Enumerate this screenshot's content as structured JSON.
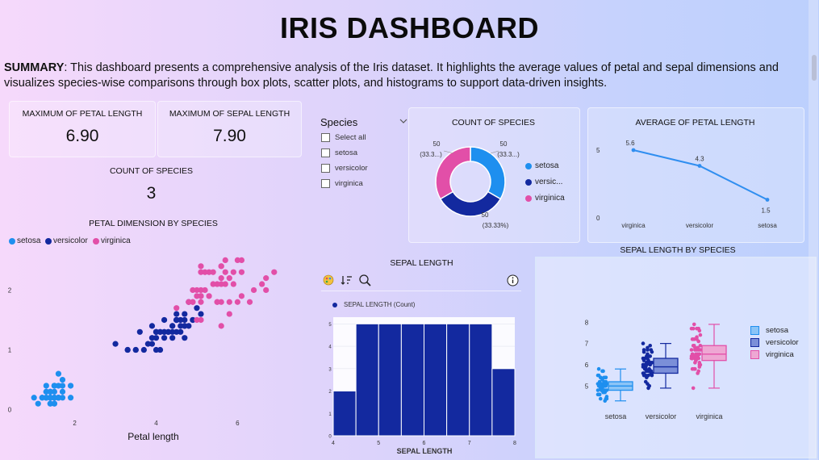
{
  "header": {
    "title": "IRIS DASHBOARD"
  },
  "summary": {
    "label": "SUMMARY",
    "text": ": This dashboard presents a comprehensive analysis of the Iris dataset. It highlights the average values of petal and sepal dimensions and visualizes species-wise comparisons through box plots, scatter plots, and histograms to support data-driven insights."
  },
  "kpis": {
    "max_petal": {
      "label": "MAXIMUM OF PETAL LENGTH",
      "value": "6.90"
    },
    "max_sepal": {
      "label": "MAXIMUM OF SEPAL LENGTH",
      "value": "7.90"
    },
    "count": {
      "label": "COUNT OF SPECIES",
      "value": "3"
    }
  },
  "slicer": {
    "title": "Species",
    "items": [
      "Select all",
      "setosa",
      "versicolor",
      "virginica"
    ]
  },
  "colors": {
    "setosa": "#1e8fef",
    "versicolor": "#13299f",
    "virginica": "#e24fa8",
    "hist": "#13299f"
  },
  "donut": {
    "title": "COUNT OF SPECIES",
    "labels": {
      "top_left": [
        "50",
        "(33.3...)"
      ],
      "top_right": [
        "50",
        "(33.3...)"
      ],
      "bottom": [
        "50",
        "(33.33%)"
      ]
    },
    "legend": [
      "setosa",
      "versic...",
      "virginica"
    ]
  },
  "line_chart": {
    "title": "AVERAGE OF PETAL LENGTH",
    "ytick_top": "5",
    "ytick_bottom": "0",
    "value_labels": [
      "5.6",
      "4.3",
      "1.5"
    ]
  },
  "scatter": {
    "title": "PETAL DIMENSION BY SPECIES",
    "legend": [
      "setosa",
      "versicolor",
      "virginica"
    ],
    "xlabel": "Petal length"
  },
  "histogram": {
    "title": "SEPAL LENGTH",
    "legend": "SEPAL LENGTH (Count)",
    "xlabel": "SEPAL LENGTH",
    "toolbar": [
      "palette-icon",
      "sort-icon",
      "zoom-icon",
      "info-icon"
    ]
  },
  "boxplot": {
    "title": "SEPAL LENGTH BY SPECIES",
    "legend": [
      "setosa",
      "versicolor",
      "virginica"
    ]
  },
  "chart_data": [
    {
      "type": "pie",
      "title": "COUNT OF SPECIES",
      "categories": [
        "setosa",
        "versicolor",
        "virginica"
      ],
      "values": [
        50,
        50,
        50
      ]
    },
    {
      "type": "line",
      "title": "AVERAGE OF PETAL LENGTH",
      "categories": [
        "virginica",
        "versicolor",
        "setosa"
      ],
      "values": [
        5.6,
        4.3,
        1.5
      ],
      "ylim": [
        0,
        6
      ]
    },
    {
      "type": "scatter",
      "title": "PETAL DIMENSION BY SPECIES",
      "xlabel": "Petal length",
      "xticks": [
        2,
        4,
        6
      ],
      "yticks": [
        0,
        1,
        2
      ],
      "xlim": [
        0.6,
        7.4
      ],
      "ylim": [
        -0.1,
        2.6
      ],
      "series": [
        {
          "name": "setosa",
          "points": [
            [
              1.4,
              0.2
            ],
            [
              1.4,
              0.2
            ],
            [
              1.3,
              0.2
            ],
            [
              1.5,
              0.2
            ],
            [
              1.4,
              0.2
            ],
            [
              1.7,
              0.4
            ],
            [
              1.4,
              0.3
            ],
            [
              1.5,
              0.2
            ],
            [
              1.4,
              0.2
            ],
            [
              1.5,
              0.1
            ],
            [
              1.5,
              0.2
            ],
            [
              1.6,
              0.2
            ],
            [
              1.4,
              0.1
            ],
            [
              1.1,
              0.1
            ],
            [
              1.2,
              0.2
            ],
            [
              1.5,
              0.4
            ],
            [
              1.3,
              0.4
            ],
            [
              1.4,
              0.3
            ],
            [
              1.7,
              0.3
            ],
            [
              1.5,
              0.3
            ],
            [
              1.7,
              0.2
            ],
            [
              1.5,
              0.4
            ],
            [
              1.0,
              0.2
            ],
            [
              1.7,
              0.5
            ],
            [
              1.9,
              0.2
            ],
            [
              1.6,
              0.2
            ],
            [
              1.6,
              0.4
            ],
            [
              1.5,
              0.2
            ],
            [
              1.4,
              0.2
            ],
            [
              1.6,
              0.2
            ],
            [
              1.6,
              0.2
            ],
            [
              1.5,
              0.4
            ],
            [
              1.5,
              0.1
            ],
            [
              1.4,
              0.2
            ],
            [
              1.5,
              0.2
            ],
            [
              1.2,
              0.2
            ],
            [
              1.3,
              0.2
            ],
            [
              1.4,
              0.1
            ],
            [
              1.3,
              0.2
            ],
            [
              1.5,
              0.2
            ],
            [
              1.3,
              0.3
            ],
            [
              1.3,
              0.3
            ],
            [
              1.3,
              0.2
            ],
            [
              1.6,
              0.6
            ],
            [
              1.9,
              0.4
            ],
            [
              1.4,
              0.3
            ],
            [
              1.6,
              0.2
            ],
            [
              1.4,
              0.2
            ],
            [
              1.5,
              0.2
            ],
            [
              1.4,
              0.2
            ]
          ]
        },
        {
          "name": "versicolor",
          "points": [
            [
              4.7,
              1.4
            ],
            [
              4.5,
              1.5
            ],
            [
              4.9,
              1.5
            ],
            [
              4.0,
              1.3
            ],
            [
              4.6,
              1.5
            ],
            [
              4.5,
              1.3
            ],
            [
              4.7,
              1.6
            ],
            [
              3.3,
              1.0
            ],
            [
              4.6,
              1.3
            ],
            [
              3.9,
              1.4
            ],
            [
              3.5,
              1.0
            ],
            [
              4.2,
              1.5
            ],
            [
              4.0,
              1.0
            ],
            [
              4.7,
              1.4
            ],
            [
              3.6,
              1.3
            ],
            [
              4.4,
              1.4
            ],
            [
              4.5,
              1.5
            ],
            [
              4.1,
              1.0
            ],
            [
              4.5,
              1.5
            ],
            [
              3.9,
              1.1
            ],
            [
              4.8,
              1.8
            ],
            [
              4.0,
              1.3
            ],
            [
              4.9,
              1.5
            ],
            [
              4.7,
              1.2
            ],
            [
              4.3,
              1.3
            ],
            [
              4.4,
              1.4
            ],
            [
              4.8,
              1.4
            ],
            [
              5.0,
              1.7
            ],
            [
              4.5,
              1.5
            ],
            [
              3.5,
              1.0
            ],
            [
              3.8,
              1.1
            ],
            [
              3.7,
              1.0
            ],
            [
              3.9,
              1.2
            ],
            [
              5.1,
              1.6
            ],
            [
              4.5,
              1.5
            ],
            [
              4.5,
              1.6
            ],
            [
              4.7,
              1.5
            ],
            [
              4.4,
              1.3
            ],
            [
              4.1,
              1.3
            ],
            [
              4.0,
              1.3
            ],
            [
              4.4,
              1.2
            ],
            [
              4.6,
              1.4
            ],
            [
              4.0,
              1.2
            ],
            [
              3.3,
              1.0
            ],
            [
              4.2,
              1.3
            ],
            [
              4.2,
              1.2
            ],
            [
              4.2,
              1.3
            ],
            [
              4.3,
              1.3
            ],
            [
              3.0,
              1.1
            ],
            [
              4.1,
              1.3
            ]
          ]
        },
        {
          "name": "virginica",
          "points": [
            [
              6.0,
              2.5
            ],
            [
              5.1,
              1.9
            ],
            [
              5.9,
              2.1
            ],
            [
              5.6,
              1.8
            ],
            [
              5.8,
              2.2
            ],
            [
              6.6,
              2.1
            ],
            [
              4.5,
              1.7
            ],
            [
              6.3,
              1.8
            ],
            [
              5.8,
              1.8
            ],
            [
              6.1,
              2.5
            ],
            [
              5.1,
              2.0
            ],
            [
              5.3,
              1.9
            ],
            [
              5.5,
              2.1
            ],
            [
              5.0,
              2.0
            ],
            [
              5.1,
              2.4
            ],
            [
              5.3,
              2.3
            ],
            [
              5.5,
              1.8
            ],
            [
              6.7,
              2.2
            ],
            [
              6.9,
              2.3
            ],
            [
              5.0,
              1.5
            ],
            [
              5.7,
              2.3
            ],
            [
              4.9,
              2.0
            ],
            [
              6.7,
              2.0
            ],
            [
              4.9,
              1.8
            ],
            [
              5.7,
              2.1
            ],
            [
              6.0,
              1.8
            ],
            [
              4.8,
              1.8
            ],
            [
              4.9,
              1.8
            ],
            [
              5.6,
              2.1
            ],
            [
              5.8,
              1.6
            ],
            [
              6.1,
              1.9
            ],
            [
              6.4,
              2.0
            ],
            [
              5.6,
              2.2
            ],
            [
              5.1,
              1.5
            ],
            [
              5.6,
              1.4
            ],
            [
              6.1,
              2.3
            ],
            [
              5.6,
              2.4
            ],
            [
              5.5,
              1.8
            ],
            [
              4.8,
              1.8
            ],
            [
              5.4,
              2.1
            ],
            [
              5.6,
              2.4
            ],
            [
              5.1,
              2.3
            ],
            [
              5.1,
              1.9
            ],
            [
              5.9,
              2.3
            ],
            [
              5.7,
              2.5
            ],
            [
              5.2,
              2.3
            ],
            [
              5.0,
              1.9
            ],
            [
              5.2,
              2.0
            ],
            [
              5.4,
              2.3
            ],
            [
              5.1,
              1.8
            ]
          ]
        }
      ]
    },
    {
      "type": "bar",
      "title": "SEPAL LENGTH",
      "xlabel": "SEPAL LENGTH",
      "bins": [
        [
          4.0,
          4.5
        ],
        [
          4.5,
          5.0
        ],
        [
          5.0,
          5.5
        ],
        [
          5.5,
          6.0
        ],
        [
          6.0,
          6.5
        ],
        [
          6.5,
          7.0
        ],
        [
          7.0,
          7.5
        ],
        [
          7.5,
          8.0
        ]
      ],
      "values": [
        2,
        5,
        5,
        5,
        5,
        5,
        5,
        3
      ],
      "xticks": [
        4,
        5,
        6,
        7,
        8
      ],
      "yticks": [
        0,
        1,
        2,
        3,
        4,
        5
      ],
      "ylim": [
        0,
        5.3
      ]
    },
    {
      "type": "box",
      "title": "SEPAL LENGTH BY SPECIES",
      "categories": [
        "setosa",
        "versicolor",
        "virginica"
      ],
      "yticks": [
        5,
        6,
        7,
        8
      ],
      "ylim": [
        4.1,
        8.2
      ],
      "boxes": [
        {
          "name": "setosa",
          "min": 4.3,
          "q1": 4.8,
          "median": 5.0,
          "q3": 5.2,
          "max": 5.8
        },
        {
          "name": "versicolor",
          "min": 4.9,
          "q1": 5.6,
          "median": 5.9,
          "q3": 6.3,
          "max": 7.0
        },
        {
          "name": "virginica",
          "min": 4.9,
          "q1": 6.2,
          "median": 6.5,
          "q3": 6.9,
          "max": 7.9
        }
      ],
      "points": {
        "setosa": [
          5.1,
          4.9,
          4.7,
          4.6,
          5.0,
          5.4,
          4.6,
          5.0,
          4.4,
          4.9,
          5.4,
          4.8,
          4.8,
          4.3,
          5.8,
          5.7,
          5.4,
          5.1,
          5.7,
          5.1,
          5.4,
          5.1,
          4.6,
          5.1,
          4.8,
          5.0,
          5.0,
          5.2,
          5.2,
          4.7,
          4.8,
          5.4,
          5.2,
          5.5,
          4.9,
          5.0,
          5.5,
          4.9,
          4.4,
          5.1,
          5.0,
          4.5,
          4.4,
          5.0,
          5.1,
          4.8,
          5.1,
          4.6,
          5.3,
          5.0
        ],
        "versicolor": [
          7.0,
          6.4,
          6.9,
          5.5,
          6.5,
          5.7,
          6.3,
          4.9,
          6.6,
          5.2,
          5.0,
          5.9,
          6.0,
          6.1,
          5.6,
          6.7,
          5.6,
          5.8,
          6.2,
          5.6,
          5.9,
          6.1,
          6.3,
          6.1,
          6.4,
          6.6,
          6.8,
          6.7,
          6.0,
          5.7,
          5.5,
          5.5,
          5.8,
          6.0,
          5.4,
          6.0,
          6.7,
          6.3,
          5.6,
          5.5,
          5.5,
          6.1,
          5.8,
          5.0,
          5.6,
          5.7,
          5.7,
          6.2,
          5.1,
          5.7
        ],
        "virginica": [
          6.3,
          5.8,
          7.1,
          6.3,
          6.5,
          7.6,
          4.9,
          7.3,
          6.7,
          7.2,
          6.5,
          6.4,
          6.8,
          5.7,
          5.8,
          6.4,
          6.5,
          7.7,
          7.7,
          6.0,
          6.9,
          5.6,
          7.7,
          6.3,
          6.7,
          7.2,
          6.2,
          6.1,
          6.4,
          7.2,
          7.4,
          7.9,
          6.4,
          6.3,
          6.1,
          7.7,
          6.3,
          6.4,
          6.0,
          6.9,
          6.7,
          6.9,
          5.8,
          6.8,
          6.7,
          6.7,
          6.3,
          6.5,
          6.2,
          5.9
        ]
      }
    }
  ]
}
